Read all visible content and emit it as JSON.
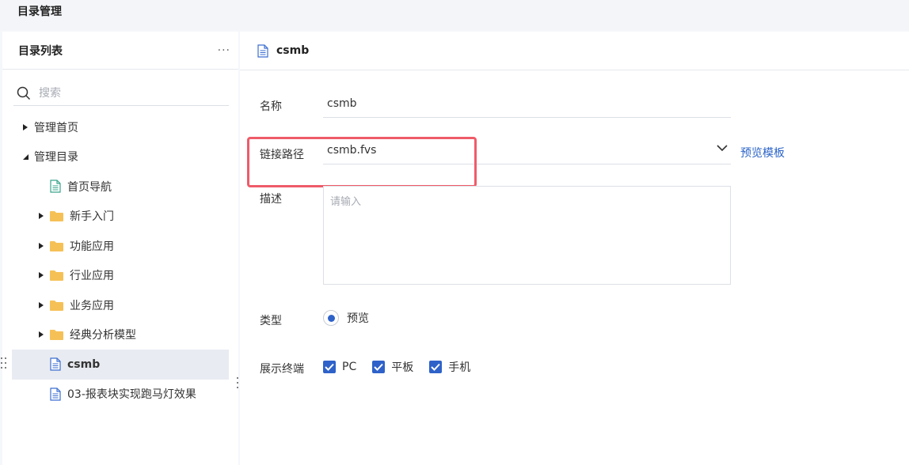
{
  "header": {
    "title": "目录管理"
  },
  "sidebar": {
    "title": "目录列表",
    "more": "···",
    "search_placeholder": "搜索",
    "items": [
      {
        "label": "管理首页",
        "type": "folder-node",
        "expanded": false
      },
      {
        "label": "管理目录",
        "type": "folder-node",
        "expanded": true
      },
      {
        "label": "首页导航",
        "type": "template",
        "icon": "page-green-icon"
      },
      {
        "label": "新手入门",
        "type": "folder",
        "icon": "folder-icon"
      },
      {
        "label": "功能应用",
        "type": "folder",
        "icon": "folder-icon"
      },
      {
        "label": "行业应用",
        "type": "folder",
        "icon": "folder-icon"
      },
      {
        "label": "业务应用",
        "type": "folder",
        "icon": "folder-icon"
      },
      {
        "label": "经典分析模型",
        "type": "folder",
        "icon": "folder-icon"
      },
      {
        "label": "csmb",
        "type": "template",
        "icon": "page-blue-icon",
        "selected": true
      },
      {
        "label": "03-报表块实现跑马灯效果",
        "type": "template",
        "icon": "page-blue-icon"
      }
    ]
  },
  "main": {
    "title": "csmb",
    "form": {
      "name_label": "名称",
      "name_value": "csmb",
      "path_label": "链接路径",
      "path_value": "csmb.fvs",
      "preview_link": "预览模板",
      "desc_label": "描述",
      "desc_placeholder": "请输入",
      "type_label": "类型",
      "type_option": "预览",
      "terminal_label": "展示终端",
      "terminals": [
        "PC",
        "平板",
        "手机"
      ]
    }
  },
  "colors": {
    "accent": "#2e62c9",
    "link": "#2b64c8",
    "highlight": "#ef5b69",
    "folder": "#f5c157"
  }
}
